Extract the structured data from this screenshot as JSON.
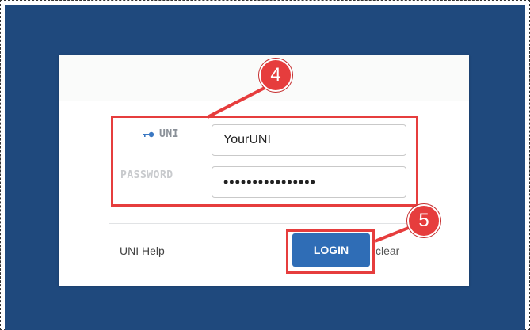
{
  "login_form": {
    "uni_label": "UNI",
    "uni_value": "YourUNI",
    "password_label": "PASSWORD",
    "password_value": "••••••••••••••••",
    "help_link": "UNI Help",
    "login_button": "LOGIN",
    "clear_link": "clear"
  },
  "annotations": {
    "step_4": "4",
    "step_5": "5"
  },
  "colors": {
    "background_blue": "#1f497d",
    "button_blue": "#2f6db6",
    "highlight_red": "#e63d3d"
  },
  "icons": {
    "uni_icon": "key-icon"
  }
}
